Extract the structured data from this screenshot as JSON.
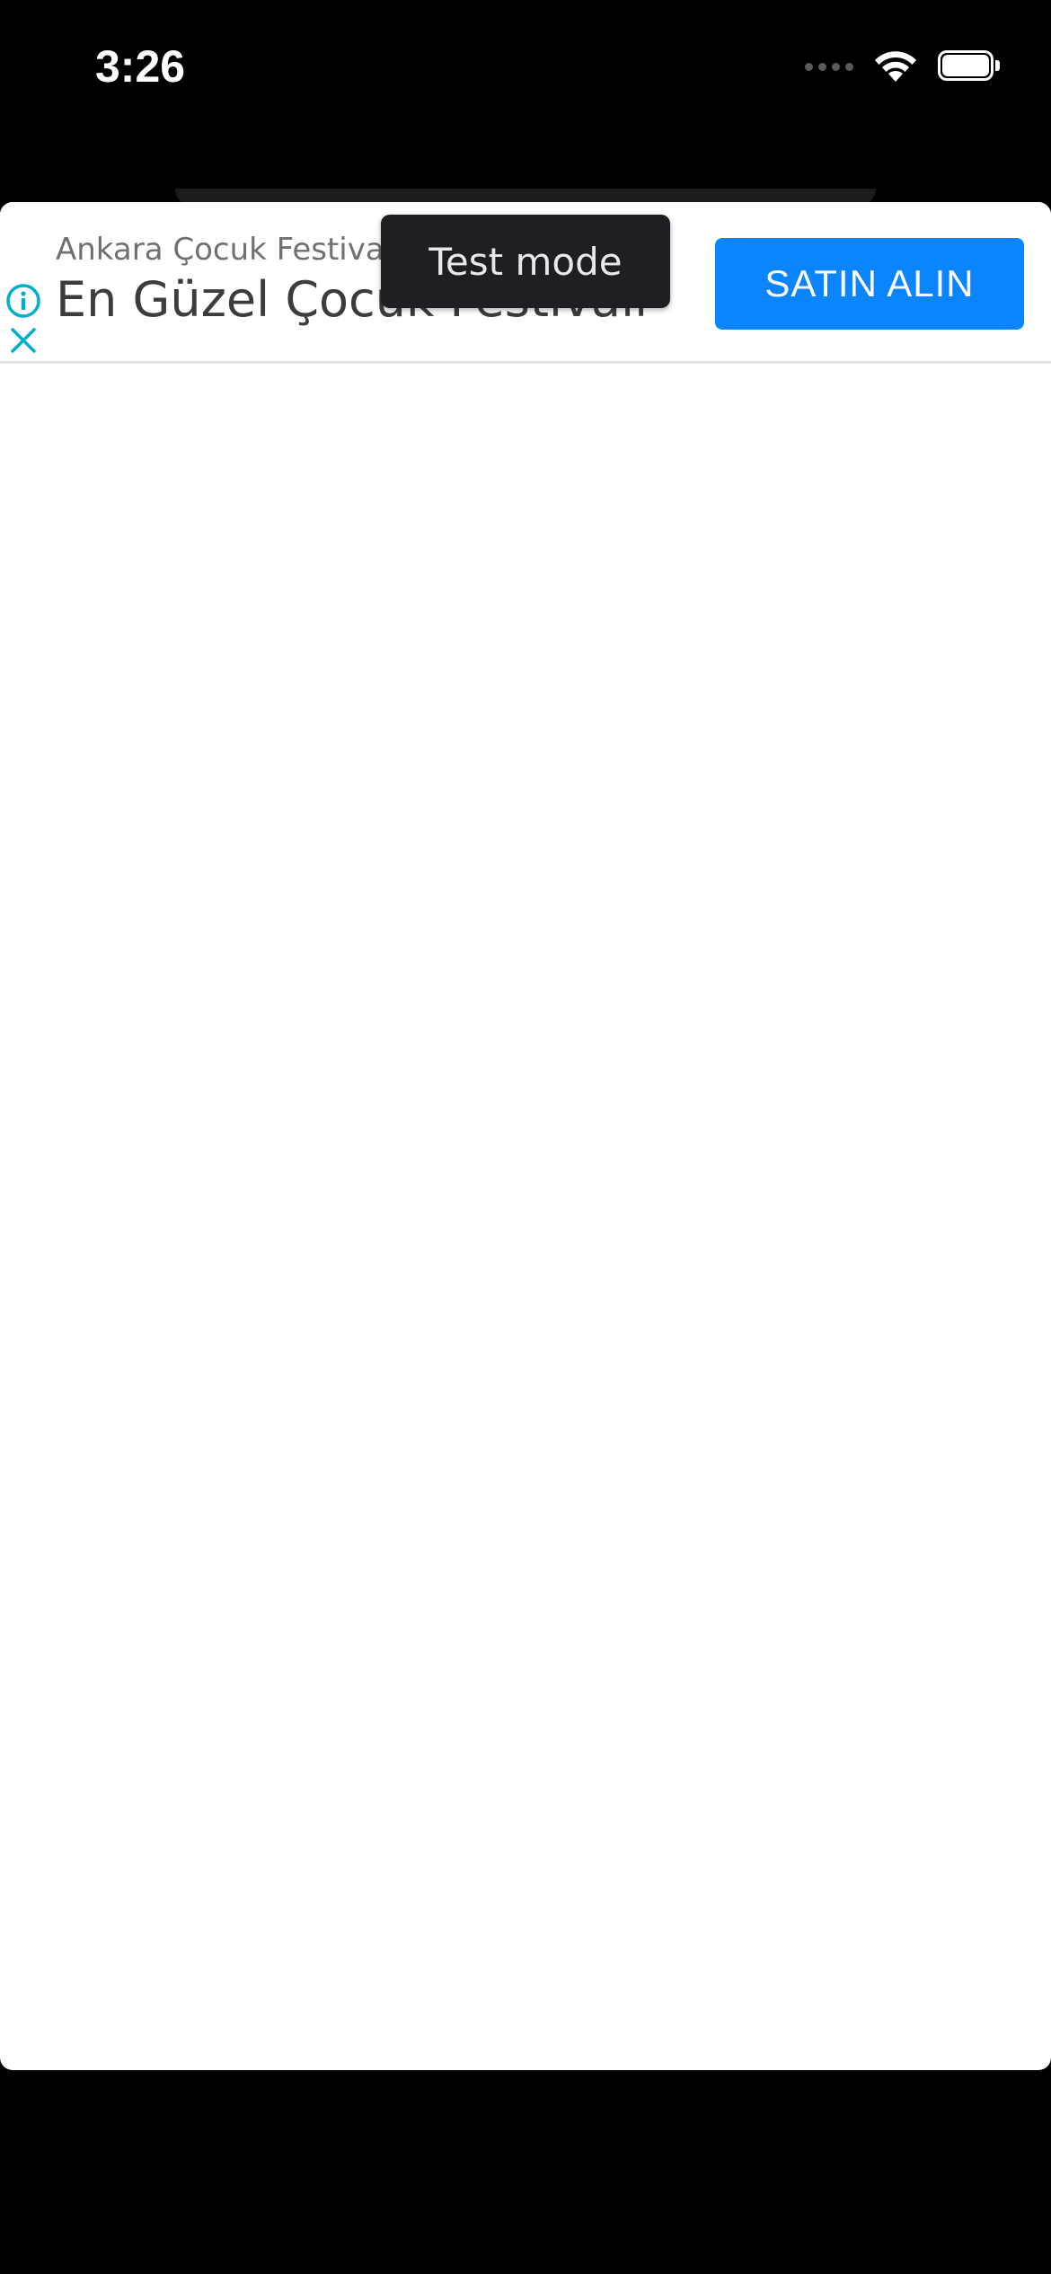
{
  "status_bar": {
    "time": "3:26",
    "icons": [
      "cellular-signal-icon",
      "wifi-icon",
      "battery-icon"
    ]
  },
  "ad": {
    "subtitle": "Ankara Çocuk Festivali",
    "headline": "En Güzel Çocuk Festivali",
    "cta_label": "SATIN ALIN",
    "test_mode_label": "Test mode",
    "icons": [
      "ad-info-icon",
      "ad-close-icon"
    ],
    "colors": {
      "cta_background": "#0a84ff",
      "ad_choices_icon": "#00aecd",
      "badge_background": "#1f1f23"
    }
  }
}
